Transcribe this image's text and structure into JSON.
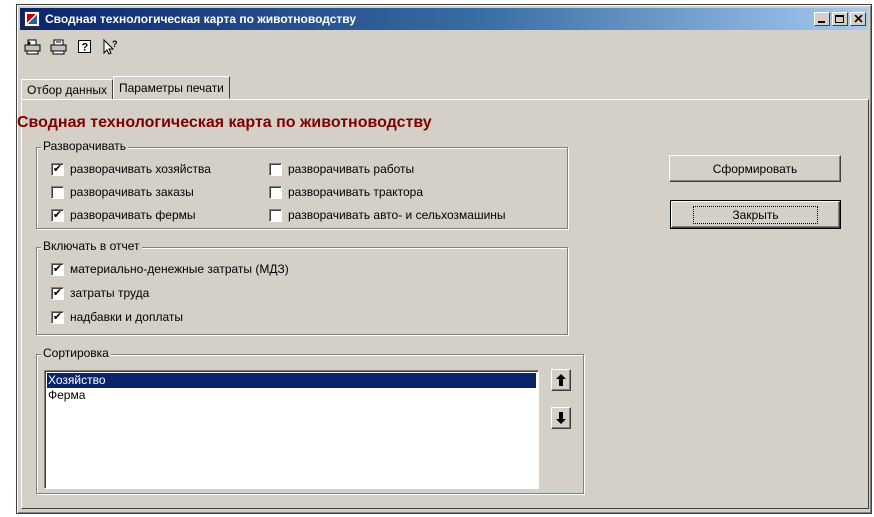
{
  "window": {
    "title": "Сводная технологическая карта по животноводству",
    "controls": {
      "minimize": "_",
      "maximize": "□",
      "close": "×"
    }
  },
  "toolbar": {
    "icons": [
      "print-preview-icon",
      "print-icon",
      "help-icon",
      "whats-this-icon"
    ]
  },
  "tabs": [
    {
      "label": "Отбор данных",
      "active": false
    },
    {
      "label": "Параметры печати",
      "active": true
    }
  ],
  "heading": "Сводная технологическая карта по животноводству",
  "expand_group": {
    "legend": "Разворачивать",
    "left": [
      {
        "label": "разворачивать хозяйства",
        "checked": true
      },
      {
        "label": "разворачивать заказы",
        "checked": false
      },
      {
        "label": "разворачивать фермы",
        "checked": true
      }
    ],
    "right": [
      {
        "label": "разворачивать работы",
        "checked": false
      },
      {
        "label": "разворачивать трактора",
        "checked": false
      },
      {
        "label": "разворачивать авто- и сельхозмашины",
        "checked": false
      }
    ]
  },
  "include_group": {
    "legend": "Включать в отчет",
    "items": [
      {
        "label": "материально-денежные затраты (МДЗ)",
        "checked": true
      },
      {
        "label": "затраты труда",
        "checked": true
      },
      {
        "label": "надбавки и доплаты",
        "checked": true
      }
    ]
  },
  "sort_group": {
    "legend": "Сортировка",
    "items": [
      {
        "label": "Хозяйство",
        "selected": true
      },
      {
        "label": "Ферма",
        "selected": false
      }
    ]
  },
  "buttons": {
    "generate": "Сформировать",
    "close": "Закрыть"
  },
  "colors": {
    "titlebar": "#0a246a",
    "heading": "#800000",
    "selection": "#0a246a",
    "face": "#d4d0c8"
  }
}
